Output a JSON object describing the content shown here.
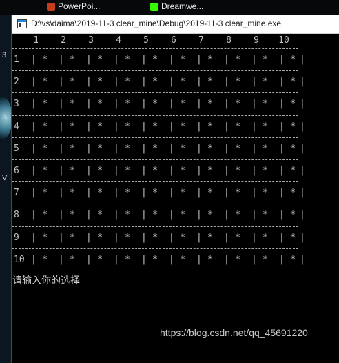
{
  "taskbar": {
    "items": [
      {
        "label": "PowerPoi...",
        "icon": "powerpoint-icon",
        "color": "#c43e1c"
      },
      {
        "label": "Dreamwe...",
        "icon": "dreamweaver-icon",
        "color": "#35fa00"
      }
    ]
  },
  "desktop": {
    "labels": [
      "3",
      "3",
      "V"
    ]
  },
  "window": {
    "title": "D:\\vs\\daima\\2019-11-3 clear_mine\\Debug\\2019-11-3 clear_mine.exe",
    "icon": "console-app-icon"
  },
  "board": {
    "column_headers": [
      "1",
      "2",
      "3",
      "4",
      "5",
      "6",
      "7",
      "8",
      "9",
      "10"
    ],
    "row_labels": [
      "1",
      "2",
      "3",
      "4",
      "5",
      "6",
      "7",
      "8",
      "9",
      "10"
    ],
    "cell_symbol": "*",
    "separator": "|"
  },
  "prompt": "请输入你的选择",
  "watermark": "https://blog.csdn.net/qq_45691220"
}
